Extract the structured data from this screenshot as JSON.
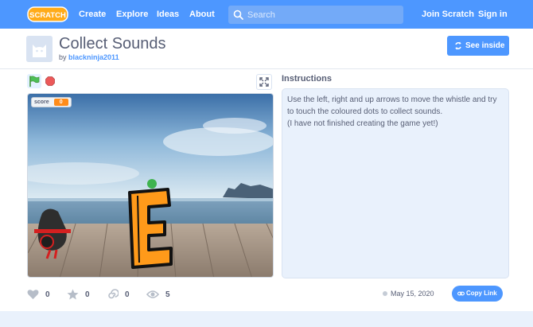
{
  "nav": {
    "logo_text": "SCRATCH",
    "links": [
      "Create",
      "Explore",
      "Ideas",
      "About"
    ],
    "search_placeholder": "Search",
    "join": "Join Scratch",
    "signin": "Sign in"
  },
  "project": {
    "title": "Collect Sounds",
    "by_prefix": "by",
    "author": "blackninja2011",
    "see_inside": "See inside"
  },
  "stage": {
    "monitor_label": "score",
    "monitor_value": "0",
    "sprite_letter": "E"
  },
  "instructions": {
    "label": "Instructions",
    "lines": [
      "Use the left, right and up arrows to move the whistle and try to touch the coloured dots to collect sounds.",
      "(I have not finished creating the game yet!)"
    ]
  },
  "stats": {
    "loves": "0",
    "favorites": "0",
    "remixes": "0",
    "views": "5",
    "date": "May 15, 2020",
    "copy_link": "Copy Link"
  },
  "colors": {
    "nav": "#4d97ff",
    "accent": "#4d97ff",
    "monitor_value": "#ff8c1a",
    "logo": "#ffab19"
  }
}
